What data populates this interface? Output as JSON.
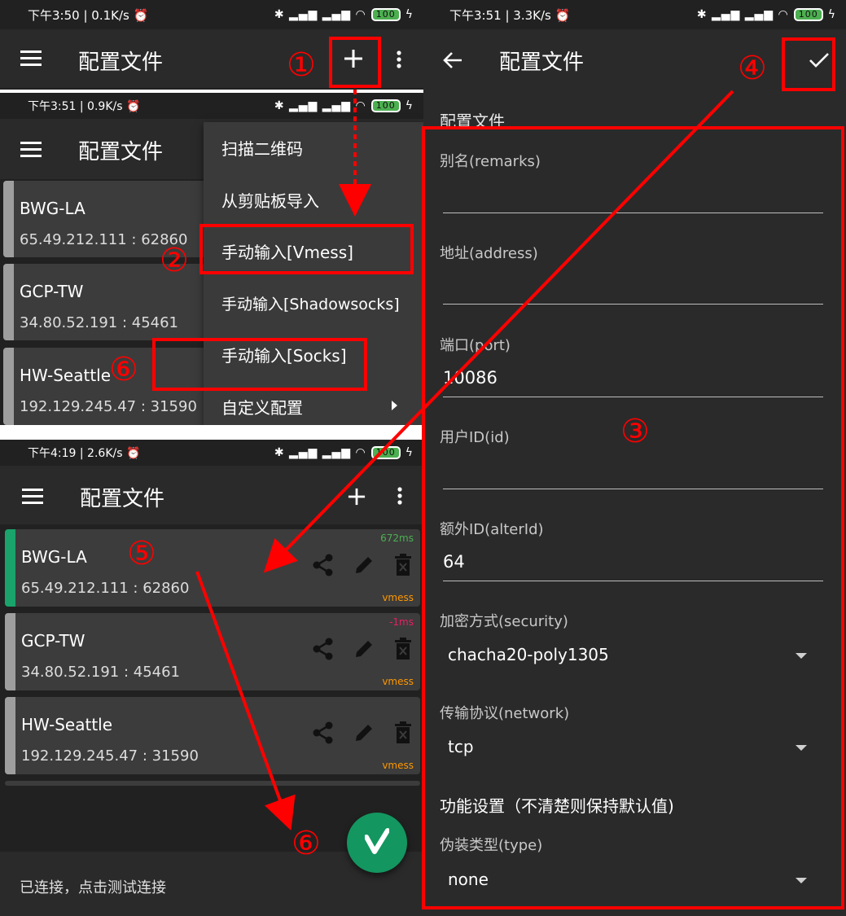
{
  "status_bars": [
    {
      "time": "下午3:50 | 0.1K/s ⏰",
      "battery": "100"
    },
    {
      "time": "下午3:51 | 0.9K/s ⏰",
      "battery": "100"
    },
    {
      "time": "下午4:19 | 2.6K/s ⏰",
      "battery": "100"
    },
    {
      "time": "下午3:51 | 3.3K/s ⏰",
      "battery": "100"
    }
  ],
  "toolbar": {
    "title": "配置文件"
  },
  "add_menu": {
    "items": [
      {
        "label": "扫描二维码"
      },
      {
        "label": "从剪贴板导入"
      },
      {
        "label": "手动输入[Vmess]"
      },
      {
        "label": "手动输入[Shadowsocks]"
      },
      {
        "label": "手动输入[Socks]"
      },
      {
        "label": "自定义配置"
      }
    ]
  },
  "servers": [
    {
      "name": "BWG-LA",
      "address": "65.49.212.111 : 62860",
      "ping": "672ms",
      "ping_color": "#4caf50",
      "type": "vmess",
      "active": true
    },
    {
      "name": "GCP-TW",
      "address": "34.80.52.191 : 45461",
      "ping": "-1ms",
      "ping_color": "#e91e63",
      "type": "vmess",
      "active": false
    },
    {
      "name": "HW-Seattle",
      "address": "192.129.245.47 : 31590",
      "ping": "",
      "ping_color": "#4caf50",
      "type": "vmess",
      "active": false
    }
  ],
  "bottom_status": "已连接，点击测试连接",
  "editor": {
    "section_title": "配置文件",
    "remarks_label": "别名(remarks)",
    "remarks_value": "",
    "address_label": "地址(address)",
    "address_value": "",
    "port_label": "端口(port)",
    "port_value": "10086",
    "id_label": "用户ID(id)",
    "id_value": "",
    "alterid_label": "额外ID(alterId)",
    "alterid_value": "64",
    "security_label": "加密方式(security)",
    "security_value": "chacha20-poly1305",
    "network_label": "传输协议(network)",
    "network_value": "tcp",
    "features_title": "功能设置（不清楚则保持默认值)",
    "type_label": "伪装类型(type)",
    "type_value": "none"
  },
  "annotations": {
    "step1": "①",
    "step2": "②",
    "step3": "③",
    "step4": "④",
    "step5": "⑤",
    "step6a": "⑥",
    "step6b": "⑥",
    "color": "#ff0000"
  },
  "colors": {
    "fab": "#139660",
    "active_bar": "#1aa36b",
    "toolbar": "#2a2a2a",
    "background": "#212121",
    "card": "#3c3c3c"
  }
}
